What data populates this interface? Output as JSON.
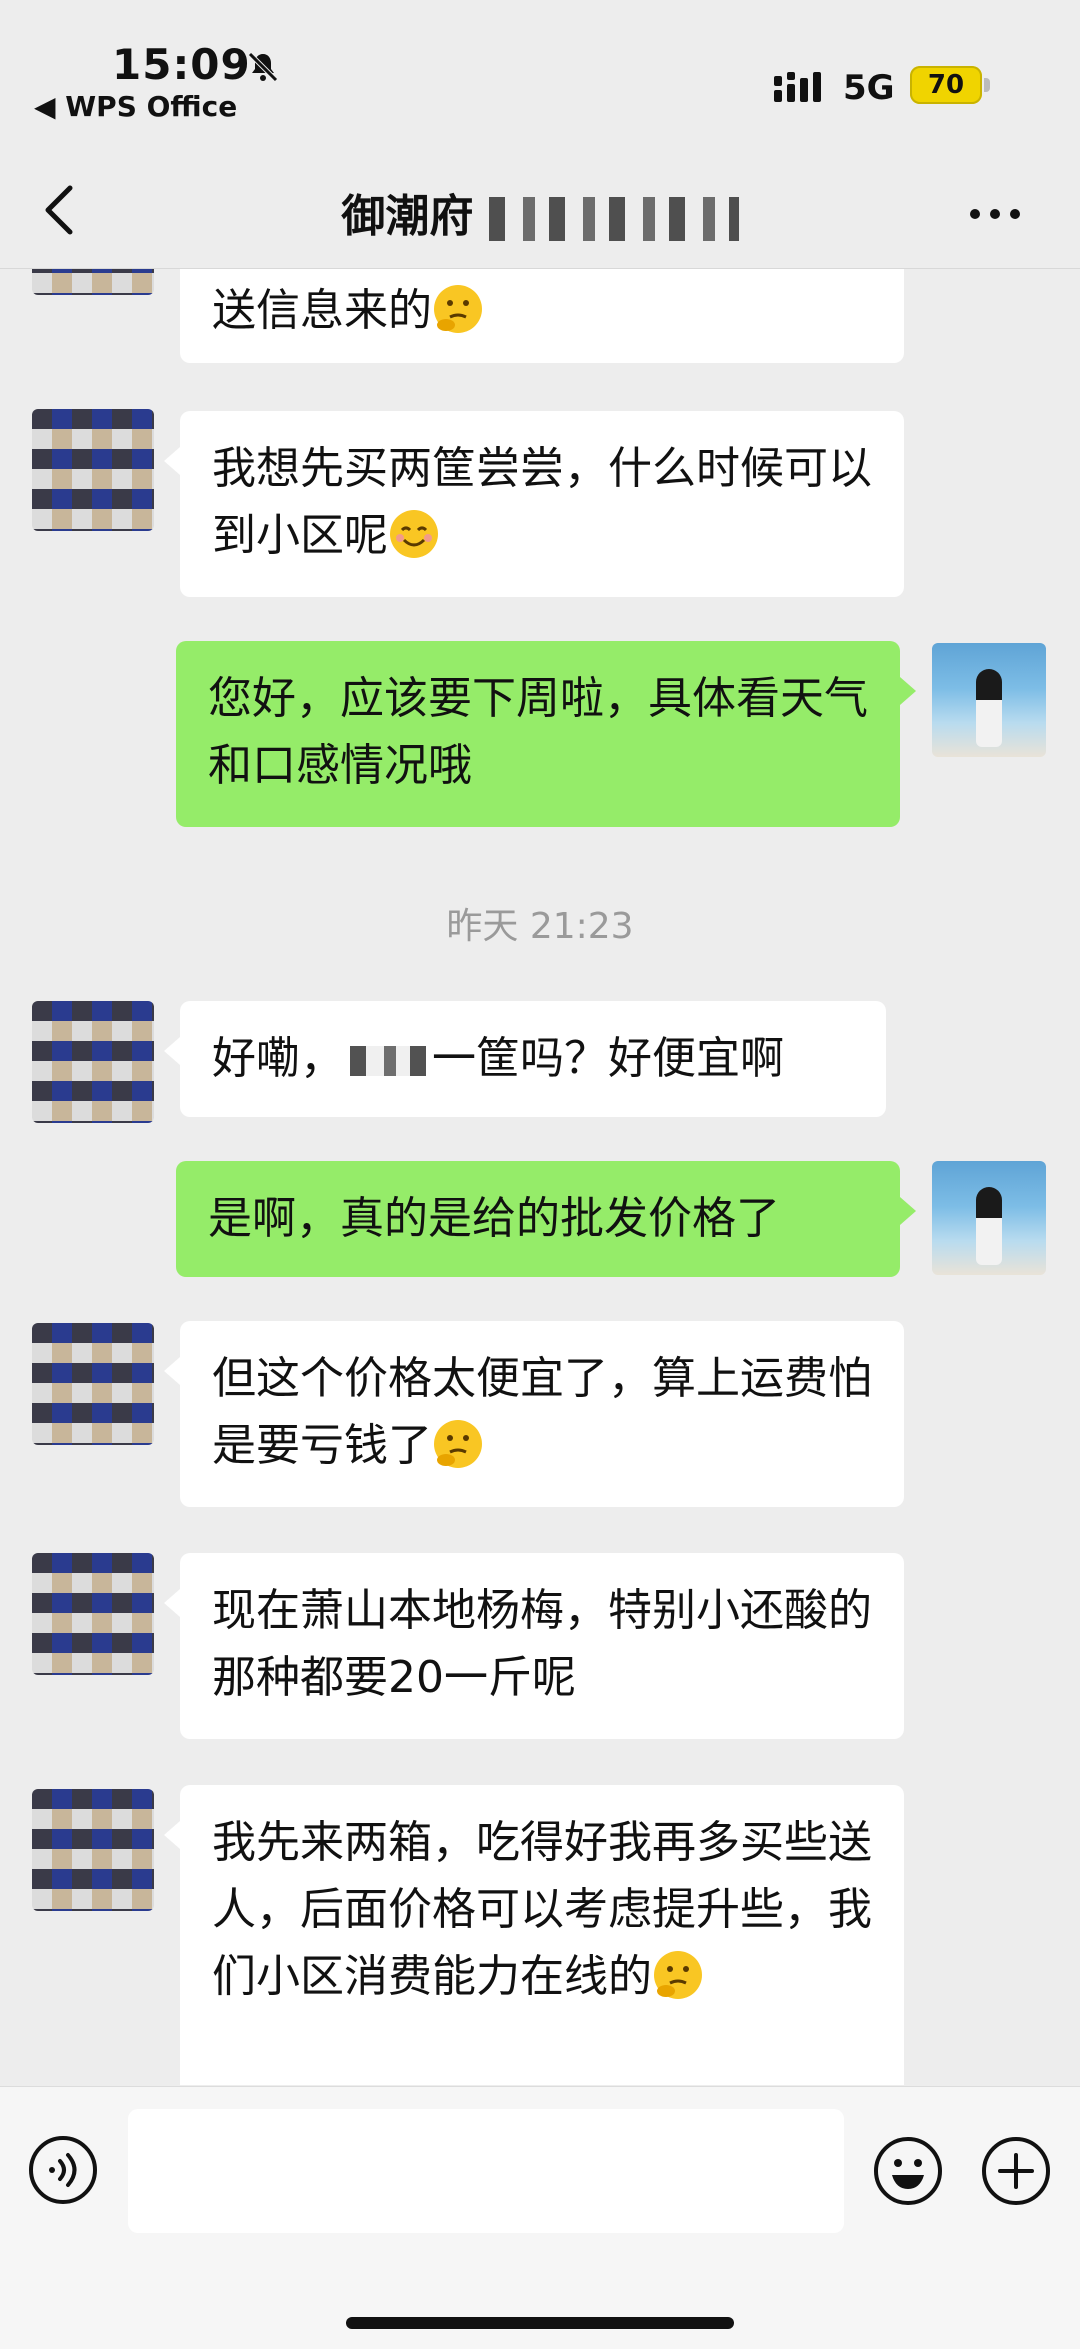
{
  "status_bar": {
    "time": "15:09",
    "back_app": "◀ WPS Office",
    "network": "5G",
    "battery": "70"
  },
  "header": {
    "title_visible": "御潮府",
    "more_icon": "more-dots-icon",
    "back_icon": "chevron-left-icon"
  },
  "messages": [
    {
      "side": "in",
      "text": "送信息来的",
      "emoji": "thinking-face"
    },
    {
      "side": "in",
      "text": "我想先买两筐尝尝，什么时候可以到小区呢",
      "emoji": "smiling-face"
    },
    {
      "side": "out",
      "text": "您好，应该要下周啦，具体看天气和口感情况哦"
    },
    {
      "side": "in",
      "text_prefix": "好嘞，",
      "text_suffix": "一筐吗？好便宜啊"
    },
    {
      "side": "out",
      "text": "是啊，真的是给的批发价格了"
    },
    {
      "side": "in",
      "text": "但这个价格太便宜了，算上运费怕是要亏钱了",
      "emoji": "thinking-face"
    },
    {
      "side": "in",
      "text": "现在萧山本地杨梅，特别小还酸的那种都要20一斤呢"
    },
    {
      "side": "in",
      "text": "我先来两箱，吃得好我再多买些送人，后面价格可以考虑提升些，我们小区消费能力在线的",
      "emoji": "thinking-face"
    }
  ],
  "timestamp": "昨天 21:23",
  "input_bar": {
    "placeholder": "",
    "voice_icon": "voice-icon",
    "emoji_icon": "emoji-icon",
    "plus_icon": "plus-icon"
  },
  "colors": {
    "bubble_out": "#95ec69",
    "bubble_in": "#ffffff",
    "background": "#ededed"
  }
}
